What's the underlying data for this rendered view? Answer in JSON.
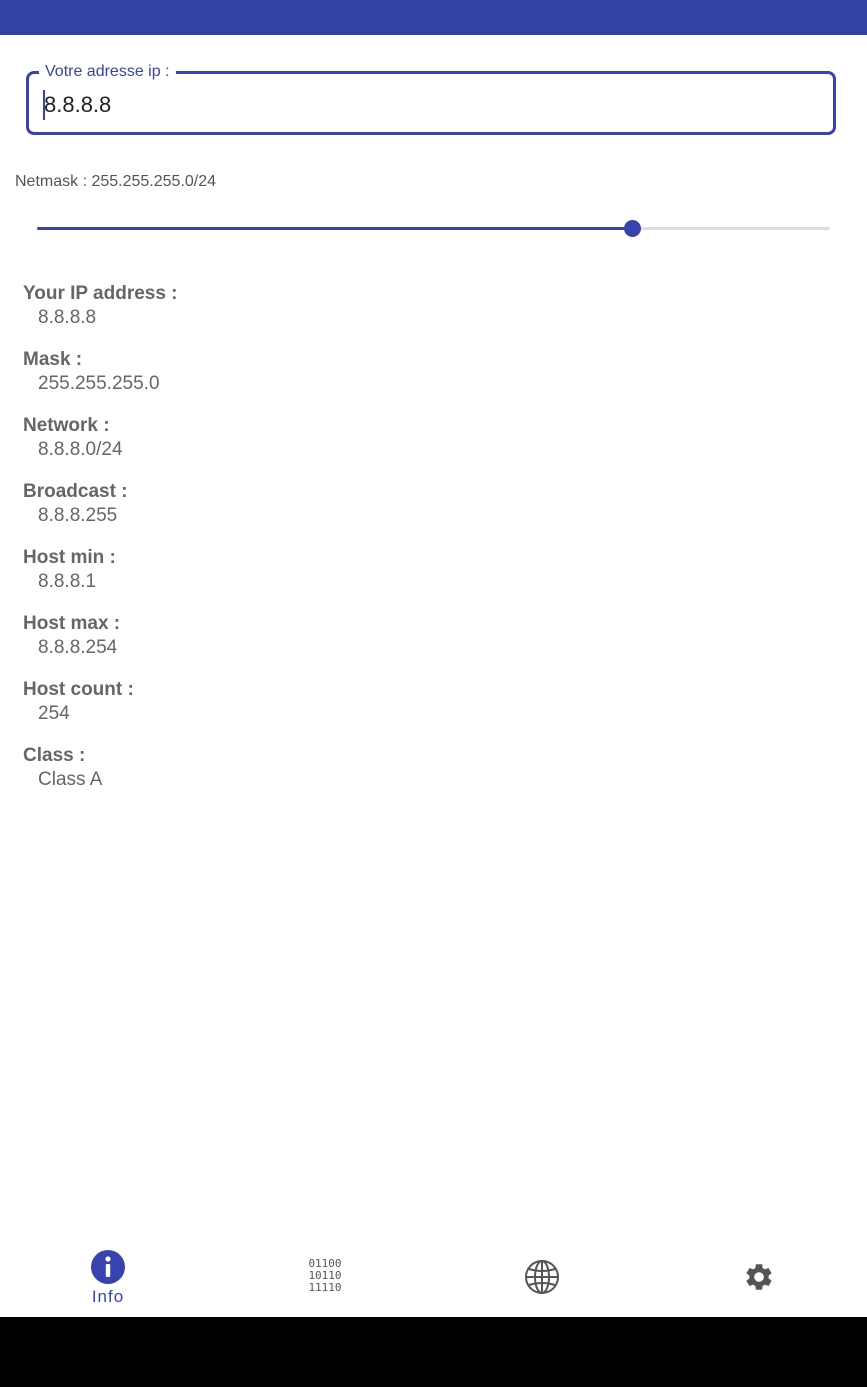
{
  "colors": {
    "primary": "#3843b0",
    "status_bar": "#3341a3",
    "system_nav_bar": "#000000",
    "text_secondary": "#666666"
  },
  "ip_input": {
    "label": "Votre adresse ip :",
    "value": "8.8.8.8"
  },
  "netmask": {
    "label": "Netmask : 255.255.255.0/24",
    "slider_level": 0.75
  },
  "info": [
    {
      "title": "Your IP address :",
      "value": "8.8.8.8"
    },
    {
      "title": "Mask :",
      "value": "255.255.255.0"
    },
    {
      "title": "Network :",
      "value": "8.8.8.0/24"
    },
    {
      "title": "Broadcast :",
      "value": "8.8.8.255"
    },
    {
      "title": "Host min :",
      "value": "8.8.8.1"
    },
    {
      "title": "Host max :",
      "value": "8.8.8.254"
    },
    {
      "title": "Host count :",
      "value": "254"
    },
    {
      "title": "Class :",
      "value": "Class A"
    }
  ],
  "bottom_nav": {
    "info_label": "Info",
    "info_icon": "info-icon",
    "binary_icon": "binary-icon",
    "binary_text": "01100\n10110\n11110",
    "globe_icon": "globe-icon",
    "settings_icon": "gear-icon"
  }
}
